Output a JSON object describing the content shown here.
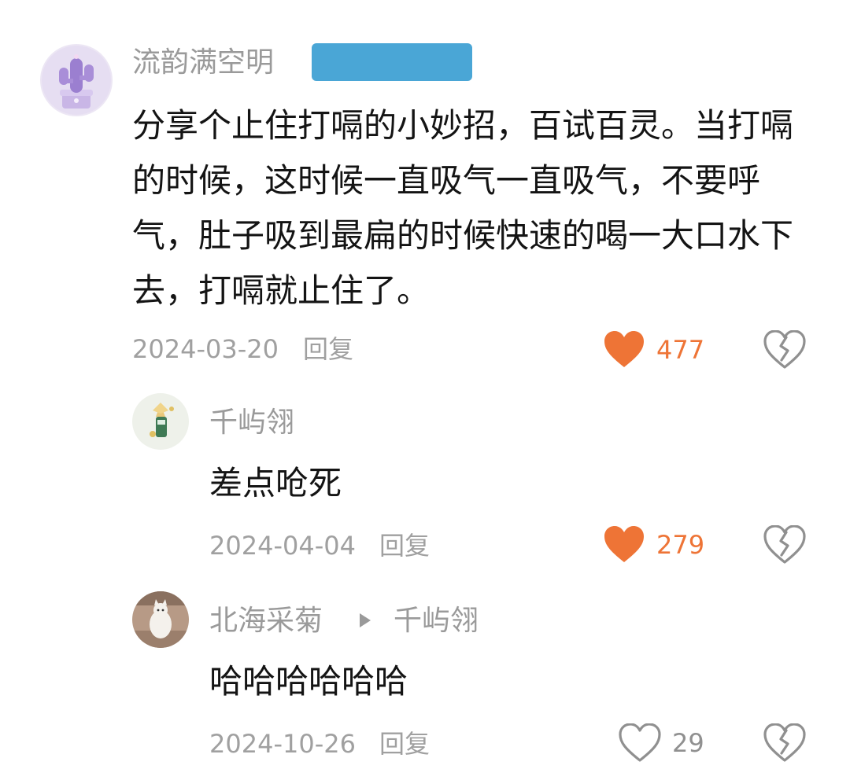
{
  "comments": [
    {
      "author": "流韵满空明",
      "text": "分享个止住打嗝的小妙招，百试百灵。当打嗝的时候，这时候一直吸气一直吸气，不要呼气，肚子吸到最扁的时候快速的喝一大口水下去，打嗝就止住了。",
      "date": "2024-03-20",
      "reply_label": "回复",
      "likes": "477",
      "liked": true
    },
    {
      "author": "千屿翎",
      "text": "差点呛死",
      "date": "2024-04-04",
      "reply_label": "回复",
      "likes": "279",
      "liked": true
    },
    {
      "author": "北海采菊",
      "reply_to": "千屿翎",
      "text": "哈哈哈哈哈哈",
      "date": "2024-10-26",
      "reply_label": "回复",
      "likes": "29",
      "liked": false
    }
  ],
  "colors": {
    "liked": "#ee7436",
    "unliked": "#909090",
    "badge": "#4aa6d6"
  }
}
